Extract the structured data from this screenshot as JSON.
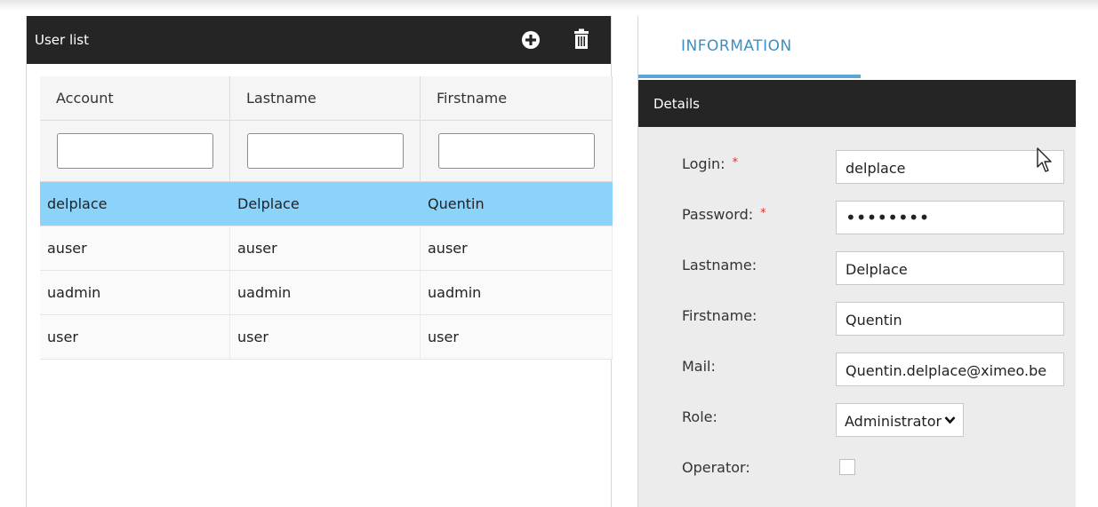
{
  "user_list": {
    "title": "User list",
    "columns": [
      "Account",
      "Lastname",
      "Firstname"
    ],
    "rows": [
      {
        "account": "delplace",
        "lastname": "Delplace",
        "firstname": "Quentin",
        "selected": true
      },
      {
        "account": "auser",
        "lastname": "auser",
        "firstname": "auser",
        "selected": false
      },
      {
        "account": "uadmin",
        "lastname": "uadmin",
        "firstname": "uadmin",
        "selected": false
      },
      {
        "account": "user",
        "lastname": "user",
        "firstname": "user",
        "selected": false
      }
    ],
    "icons": {
      "add": "plus-circle-icon",
      "delete": "trash-icon"
    }
  },
  "details": {
    "tab": "INFORMATION",
    "header": "Details",
    "fields": {
      "login": {
        "label": "Login:",
        "value": "delplace",
        "required": "*"
      },
      "password": {
        "label": "Password:",
        "value": "••••••••",
        "required": "*"
      },
      "lastname": {
        "label": "Lastname:",
        "value": "Delplace"
      },
      "firstname": {
        "label": "Firstname:",
        "value": "Quentin"
      },
      "mail": {
        "label": "Mail:",
        "value": "Quentin.delplace@ximeo.be"
      },
      "role": {
        "label": "Role:",
        "value": "Administrator"
      },
      "operator": {
        "label": "Operator:",
        "checked": false
      }
    }
  },
  "colors": {
    "header_bg": "#252525",
    "selected_row": "#8bd3fb",
    "tab_accent": "#3d8fc4",
    "required": "#d9322f"
  }
}
